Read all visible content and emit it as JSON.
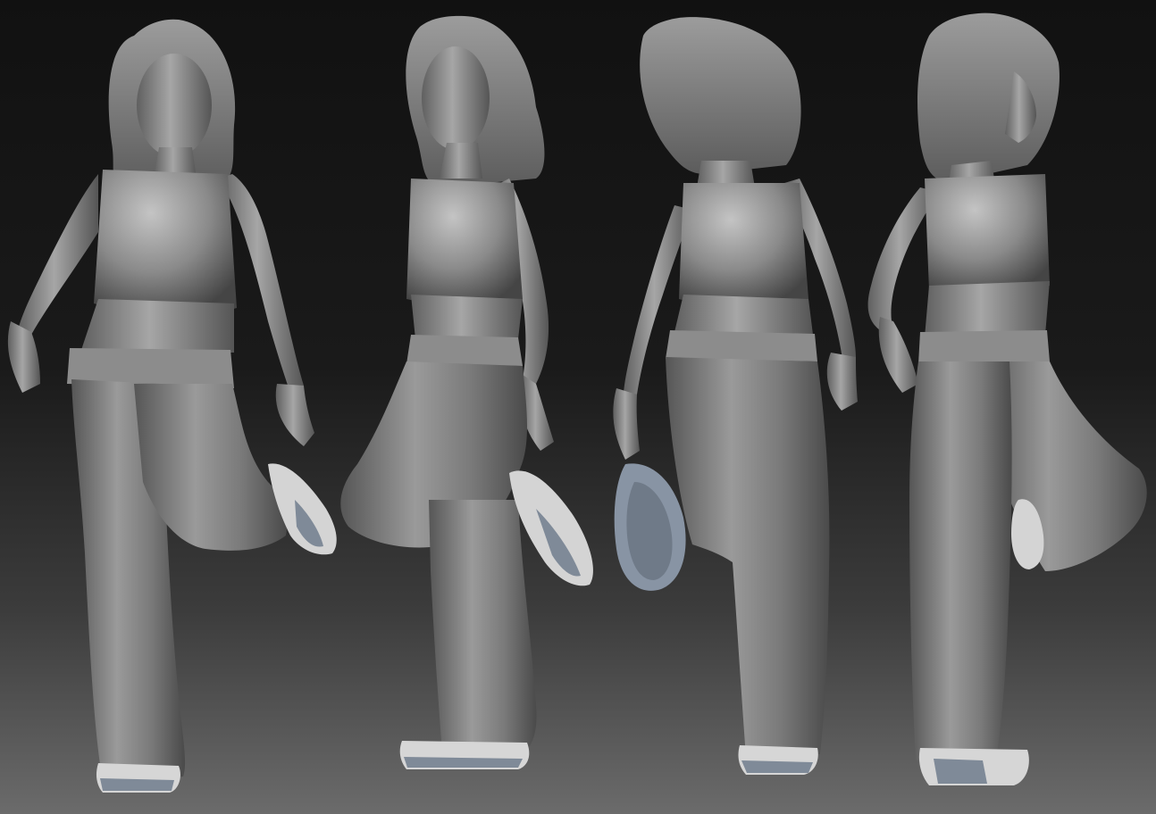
{
  "scene": {
    "background_top": "#111111",
    "background_bottom": "#6b6b6b",
    "clay_color": "#8a8a8a",
    "clay_shadow": "#4a4a4a",
    "clay_highlight": "#c8c8c8",
    "shoe_accent": "#7f8a98",
    "shoe_white": "#d8d8d8",
    "views": [
      {
        "name": "front-view",
        "facing": "front",
        "raised_leg": "left"
      },
      {
        "name": "three-quarter-view",
        "facing": "side-left",
        "raised_leg": "right"
      },
      {
        "name": "back-view",
        "facing": "back",
        "raised_leg": "left"
      },
      {
        "name": "side-view",
        "facing": "side-right",
        "raised_leg": "right"
      }
    ]
  }
}
